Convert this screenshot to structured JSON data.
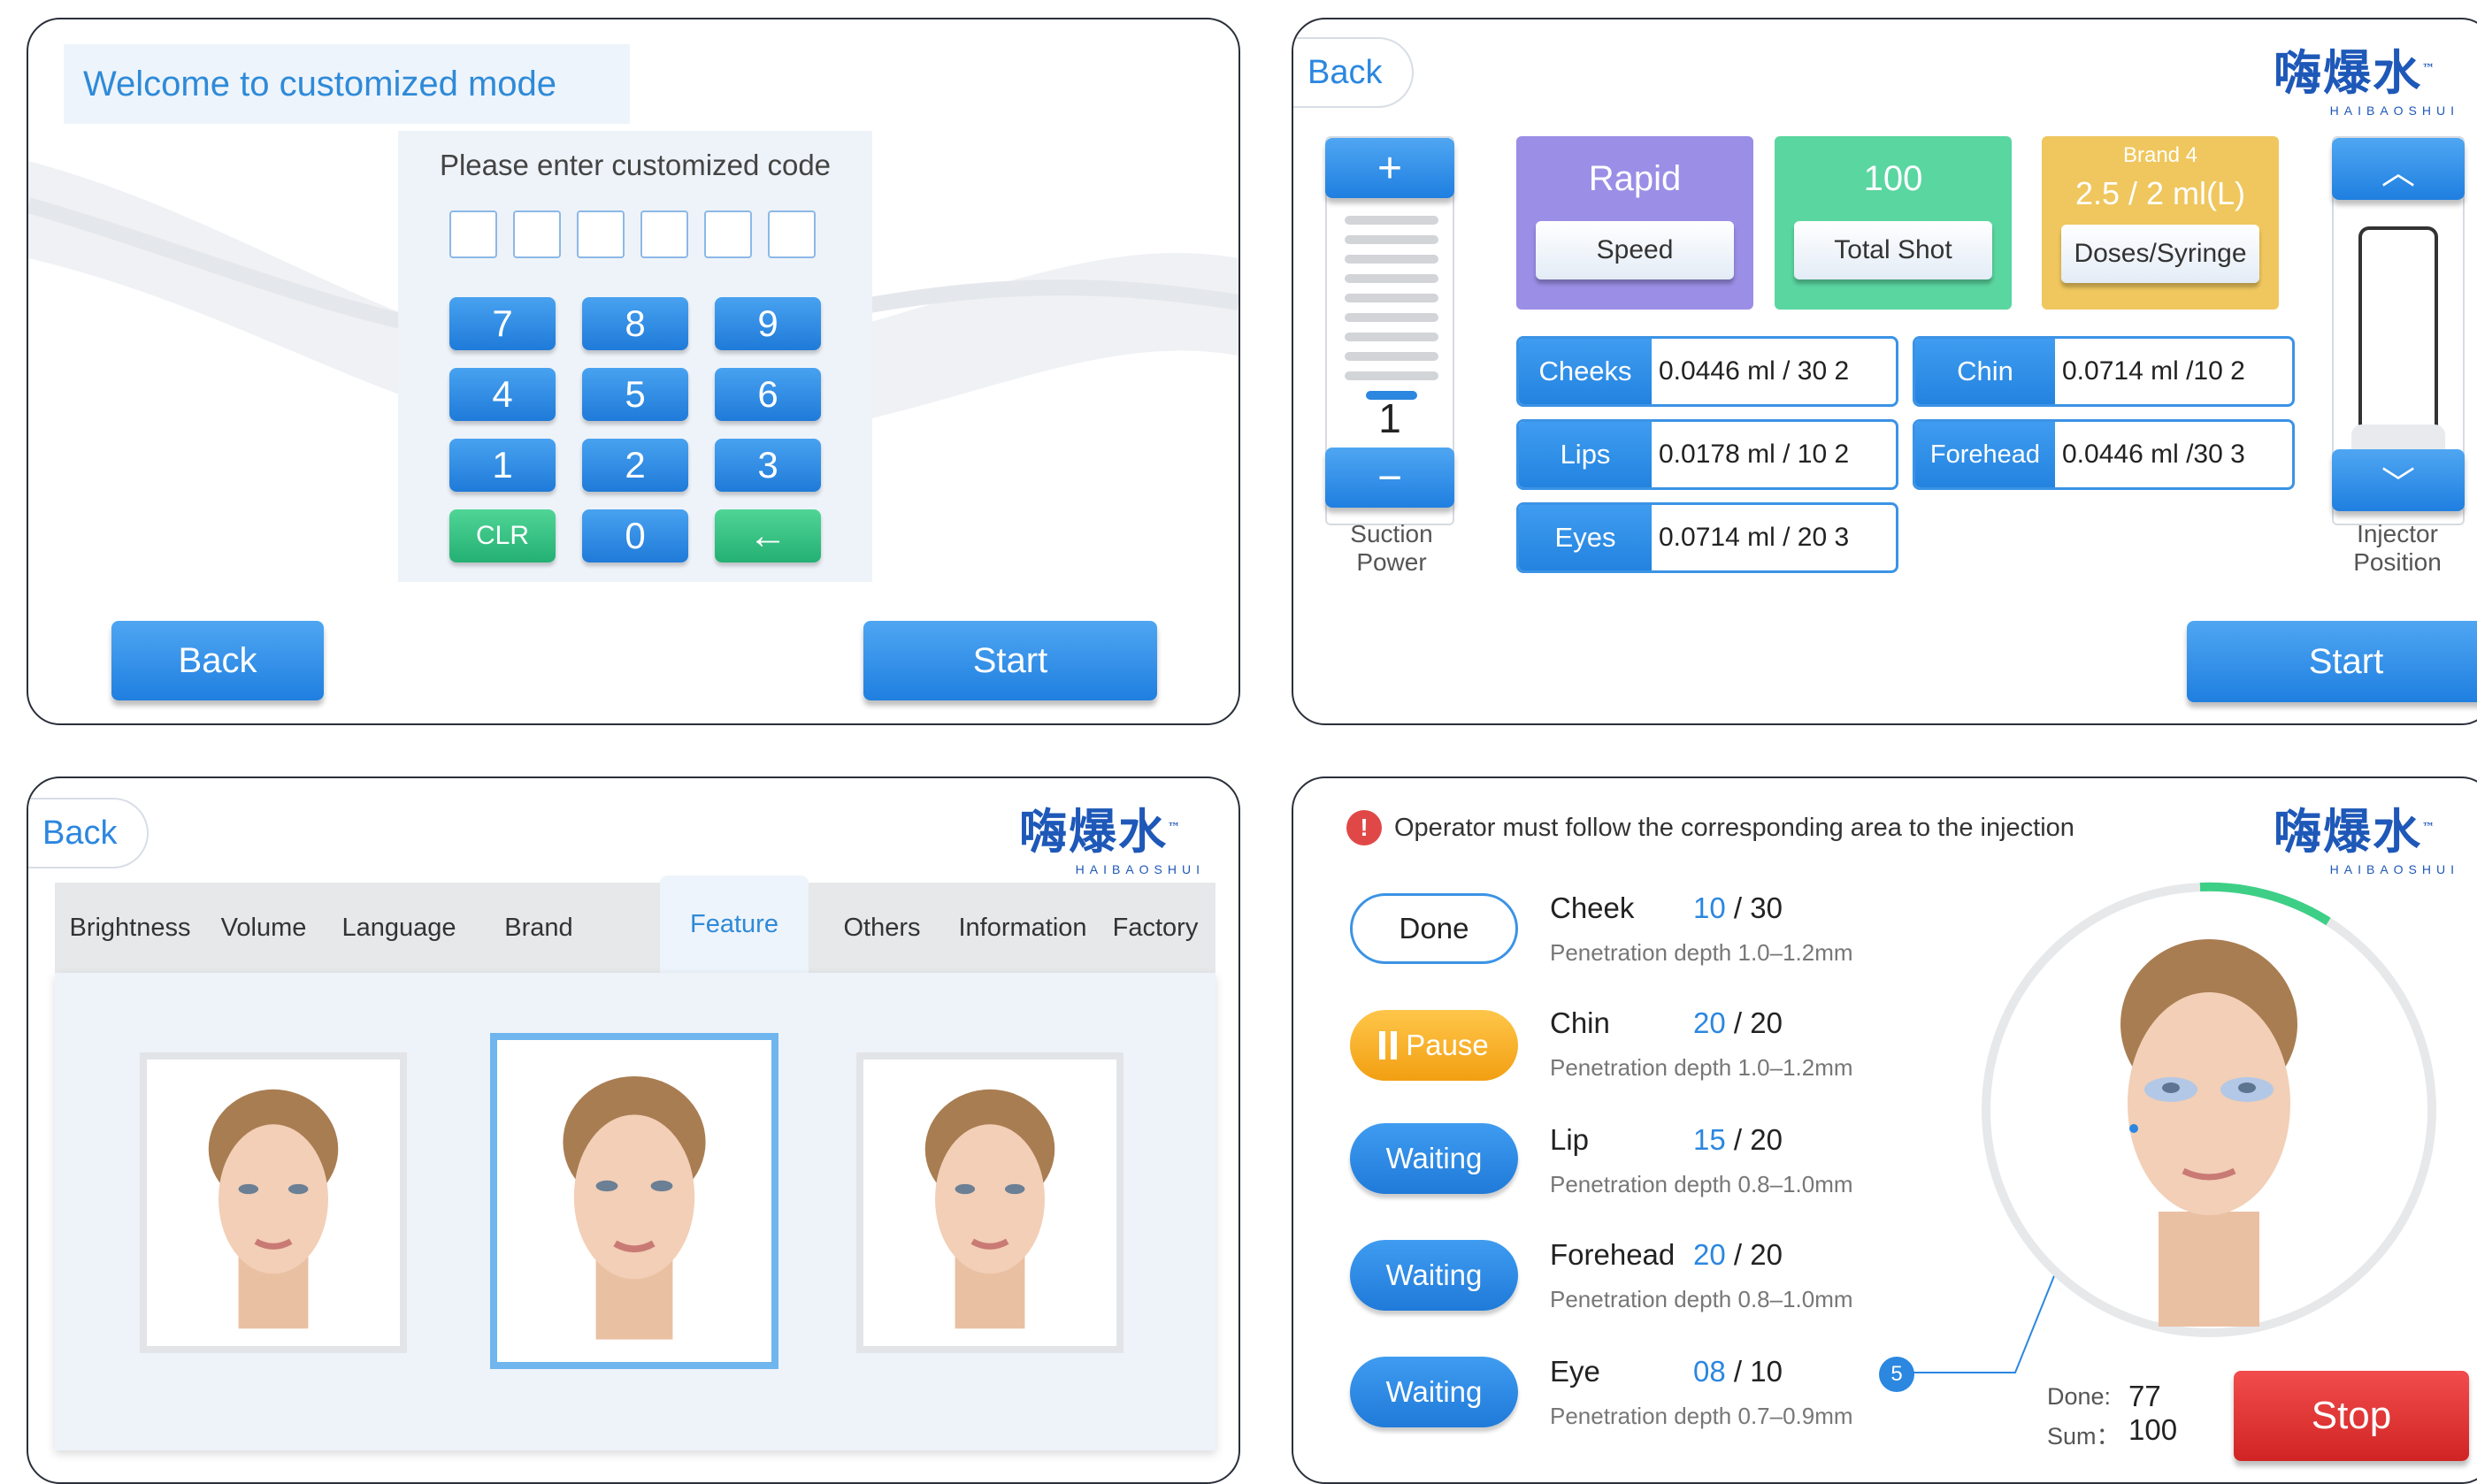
{
  "panel1": {
    "welcome": "Welcome to customized mode",
    "prompt": "Please enter customized code",
    "keys": [
      "7",
      "8",
      "9",
      "4",
      "5",
      "6",
      "1",
      "2",
      "3",
      "CLR",
      "0",
      "←"
    ],
    "back": "Back",
    "start": "Start"
  },
  "panel2": {
    "back": "Back",
    "plus": "+",
    "minus": "−",
    "suction_value": "1",
    "suction_label_1": "Suction",
    "suction_label_2": "Power",
    "speed_value": "Rapid",
    "speed_label": "Speed",
    "total_value": "100",
    "total_label": "Total Shot",
    "brand_name": "Brand 4",
    "brand_value": "2.5  /  2 ml(L)",
    "brand_label": "Doses/Syringe",
    "areas": [
      {
        "name": "Cheeks",
        "value": "0.0446 ml / 30  2"
      },
      {
        "name": "Chin",
        "value": "0.0714 ml /10  2"
      },
      {
        "name": "Lips",
        "value": "0.0178 ml / 10  2"
      },
      {
        "name": "Forehead",
        "value": "0.0446 ml /30  3"
      },
      {
        "name": "Eyes",
        "value": "0.0714 ml / 20  3"
      }
    ],
    "up": "︿",
    "down": "﹀",
    "injector_label_1": "Injector",
    "injector_label_2": "Position",
    "start": "Start"
  },
  "panel3": {
    "back": "Back",
    "tabs": [
      "Brightness",
      "Volume",
      "Language",
      "Brand",
      "Feature",
      "Others",
      "Information",
      "Factory"
    ],
    "active_tab": "Feature"
  },
  "panel4": {
    "notice": "Operator must follow the corresponding area to the injection",
    "notice_icon": "!",
    "zones": [
      {
        "status": "Done",
        "name": "Cheek",
        "current": "10",
        "total": " / 30",
        "depth": "Penetration depth 1.0–1.2mm"
      },
      {
        "status": "Pause",
        "name": "Chin",
        "current": "20",
        "total": " / 20",
        "depth": "Penetration depth 1.0–1.2mm"
      },
      {
        "status": "Waiting",
        "name": "Lip",
        "current": "15",
        "total": " / 20",
        "depth": "Penetration depth 0.8–1.0mm"
      },
      {
        "status": "Waiting",
        "name": "Forehead",
        "current": "20",
        "total": " / 20",
        "depth": "Penetration depth 0.8–1.0mm"
      },
      {
        "status": "Waiting",
        "name": "Eye",
        "current": "08",
        "total": " / 10",
        "depth": "Penetration depth 0.7–0.9mm"
      }
    ],
    "marker": "5",
    "done_label": "Done:",
    "done_value": "77",
    "sum_label": "Sum：",
    "sum_value": "100",
    "stop": "Stop"
  },
  "logo": {
    "main": "嗨爆水",
    "sub": "HAIBAOSHUI",
    "tm": "™"
  },
  "colors": {
    "primary": "#2383df",
    "green": "#24b073",
    "red": "#d02424",
    "orange": "#f29f12",
    "purple": "#9b8ee6",
    "teal": "#5ad6a0",
    "gold": "#f0c75e"
  }
}
